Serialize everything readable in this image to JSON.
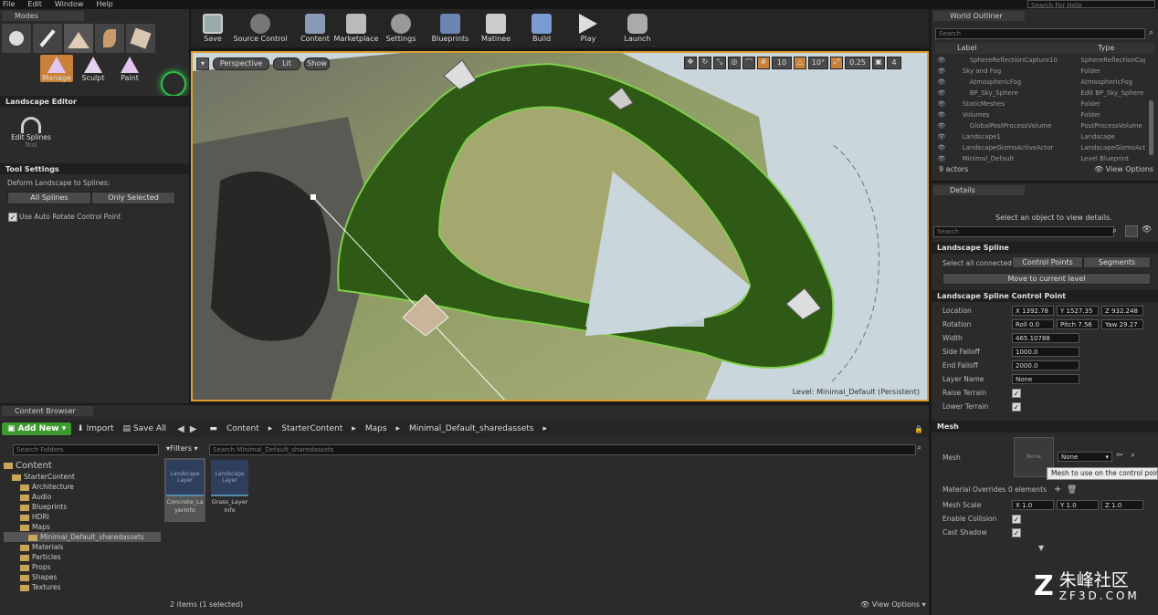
{
  "menu": {
    "items": [
      "File",
      "Edit",
      "Window",
      "Help"
    ],
    "search_placeholder": "Search For Help"
  },
  "modes": {
    "tab": "Modes",
    "buttons": [
      "Manage",
      "Sculpt",
      "Paint"
    ],
    "landscape_editor": "Landscape Editor",
    "edit_splines": "Edit Splines",
    "edit_splines_sub": "Tool",
    "tool_settings": "Tool Settings",
    "deform_label": "Deform Landscape to Splines:",
    "all_splines": "All Splines",
    "only_selected": "Only Selected",
    "auto_rotate": "Use Auto Rotate Control Point"
  },
  "toolbar": {
    "items": [
      "Save",
      "Source Control",
      "Content",
      "Marketplace",
      "Settings",
      "Blueprints",
      "Matinee",
      "Build",
      "Play",
      "Launch"
    ]
  },
  "viewport": {
    "perspective": "Perspective",
    "lit": "Lit",
    "show": "Show",
    "grid_snap": "10",
    "rot_snap": "10°",
    "scale_snap": "0.25",
    "cam_speed": "4",
    "level_text": "Level:  Minimal_Default (Persistent)"
  },
  "outliner": {
    "tab": "World Outliner",
    "search_placeholder": "Search",
    "col_label": "Label",
    "col_type": "Type",
    "rows": [
      {
        "label": "SphereReflectionCapture10",
        "type": "SphereReflectionCapture",
        "indent": 3
      },
      {
        "label": "Sky and Fog",
        "type": "Folder",
        "indent": 2
      },
      {
        "label": "AtmosphericFog",
        "type": "AtmosphericFog",
        "indent": 3
      },
      {
        "label": "BP_Sky_Sphere",
        "type": "Edit BP_Sky_Sphere",
        "indent": 3
      },
      {
        "label": "StaticMeshes",
        "type": "Folder",
        "indent": 2
      },
      {
        "label": "Volumes",
        "type": "Folder",
        "indent": 2
      },
      {
        "label": "GlobalPostProcessVolume",
        "type": "PostProcessVolume",
        "indent": 3
      },
      {
        "label": "Landscape1",
        "type": "Landscape",
        "indent": 2
      },
      {
        "label": "LandscapeGizmoActiveActor",
        "type": "LandscapeGizmoActiveActor",
        "indent": 2
      },
      {
        "label": "Minimal_Default",
        "type": "Level Blueprint",
        "indent": 2
      }
    ],
    "count": "9 actors",
    "view_options": "View Options"
  },
  "details": {
    "tab": "Details",
    "hint": "Select an object to view details.",
    "search_placeholder": "Search",
    "spline_section": "Landscape Spline",
    "select_connected": "Select all connected:",
    "control_points": "Control Points",
    "segments": "Segments",
    "move_to_level": "Move to current level",
    "cp_section": "Landscape Spline Control Point",
    "location_label": "Location",
    "loc_x": "1392.78",
    "loc_y": "1527.35",
    "loc_z": "932.248",
    "rotation_label": "Rotation",
    "roll": "0.0",
    "pitch": "7.56",
    "yaw": "29.27",
    "width_label": "Width",
    "width": "465.10788",
    "side_falloff_label": "Side Falloff",
    "side_falloff": "1000.0",
    "end_falloff_label": "End Falloff",
    "end_falloff": "2000.0",
    "layer_name_label": "Layer Name",
    "layer_name": "None",
    "raise_terrain": "Raise Terrain",
    "lower_terrain": "Lower Terrain",
    "mesh_section": "Mesh",
    "mesh_label": "Mesh",
    "mesh_thumb": "None",
    "mesh_value": "None",
    "tooltip": "Mesh to use on the control point",
    "material_overrides": "Material Overrides",
    "material_count": "0 elements",
    "mesh_scale": "Mesh Scale",
    "scale_x": "1.0",
    "scale_y": "1.0",
    "scale_z": "1.0",
    "enable_collision": "Enable Collision",
    "cast_shadow": "Cast Shadow"
  },
  "content": {
    "tab": "Content Browser",
    "add_new": "Add New",
    "import": "Import",
    "save_all": "Save All",
    "path": [
      "Content",
      "StarterContent",
      "Maps",
      "Minimal_Default_sharedassets"
    ],
    "search_folders": "Search Folders",
    "filters": "Filters",
    "search_assets": "Search Minimal_Default_sharedassets",
    "tree": [
      {
        "name": "Content",
        "indent": 0,
        "big": true
      },
      {
        "name": "StarterContent",
        "indent": 1
      },
      {
        "name": "Architecture",
        "indent": 2
      },
      {
        "name": "Audio",
        "indent": 2
      },
      {
        "name": "Blueprints",
        "indent": 2
      },
      {
        "name": "HDRI",
        "indent": 2
      },
      {
        "name": "Maps",
        "indent": 2
      },
      {
        "name": "Minimal_Default_sharedassets",
        "indent": 3,
        "selected": true
      },
      {
        "name": "Materials",
        "indent": 2
      },
      {
        "name": "Particles",
        "indent": 2
      },
      {
        "name": "Props",
        "indent": 2
      },
      {
        "name": "Shapes",
        "indent": 2
      },
      {
        "name": "Textures",
        "indent": 2
      }
    ],
    "assets": [
      {
        "thumb": "Landscape Layer",
        "name": "Concrete_LayerInfo",
        "selected": true
      },
      {
        "thumb": "Landscape Layer",
        "name": "Grass_Layer Info",
        "selected": false
      }
    ],
    "status": "2 items (1 selected)",
    "view_options": "View Options"
  },
  "watermark": {
    "cn": "朱峰社区",
    "en": "ZF3D.COM"
  }
}
